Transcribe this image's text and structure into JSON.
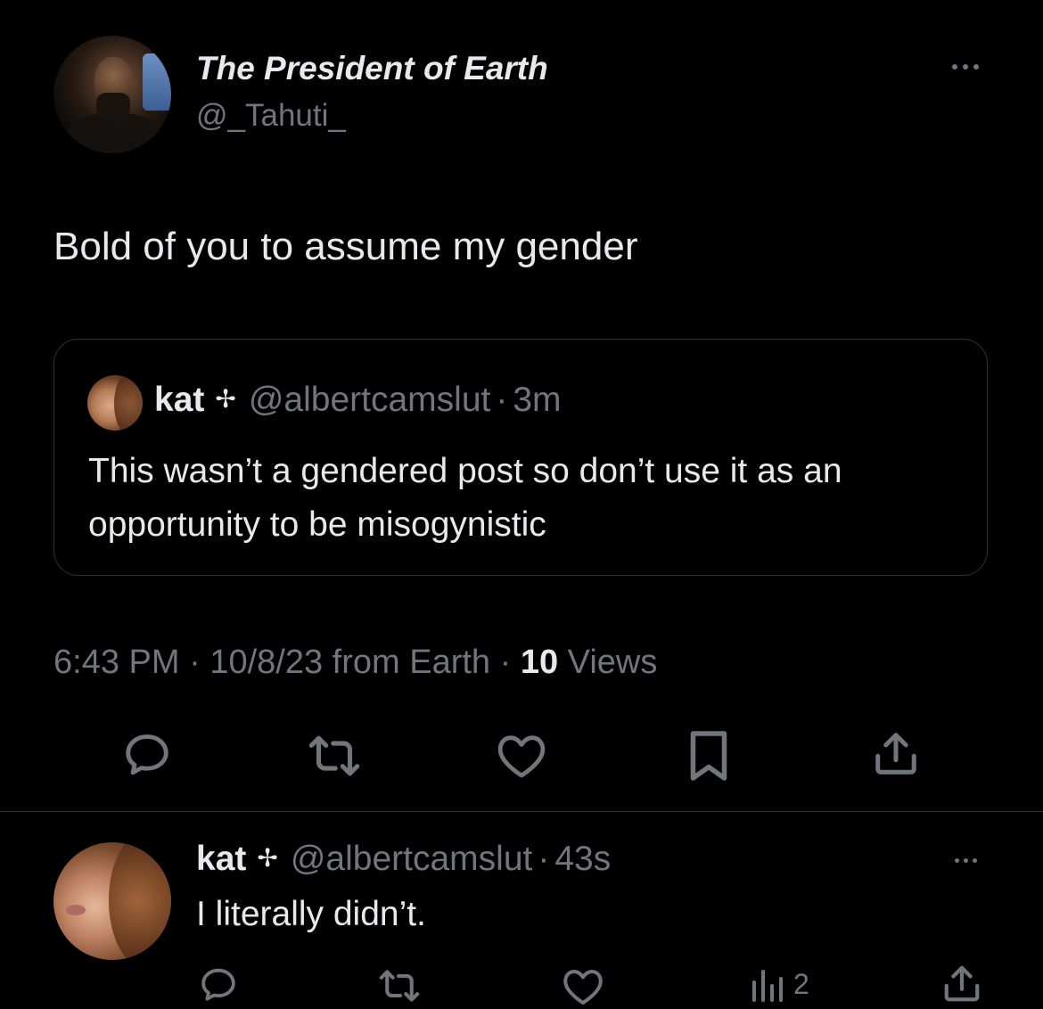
{
  "colors": {
    "background": "#000000",
    "text_primary": "#e7e9ea",
    "text_secondary": "#71767b",
    "border": "#2f3336"
  },
  "main_tweet": {
    "display_name": "The President of Earth",
    "handle": "@_Tahuti_",
    "text": "Bold of you to assume my gender",
    "quoted": {
      "name": "kat",
      "name_icon": "cross-icon",
      "handle": "@albertcamslut",
      "separator": "·",
      "time": "3m",
      "text": "This wasn’t a gendered post so don’t use it as an opportunity to be misogynistic"
    },
    "meta": {
      "time": "6:43 PM",
      "sep1": " · ",
      "date": "10/8/23",
      "source": " from Earth",
      "sep2": " · ",
      "views_count": "10",
      "views_label": " Views"
    },
    "actions": [
      "reply-icon",
      "retweet-icon",
      "like-icon",
      "bookmark-icon",
      "share-icon"
    ]
  },
  "reply": {
    "name": "kat",
    "name_icon": "cross-icon",
    "handle": "@albertcamslut",
    "separator": "·",
    "time": "43s",
    "text": "I literally didn’t.",
    "views_count": "2"
  }
}
